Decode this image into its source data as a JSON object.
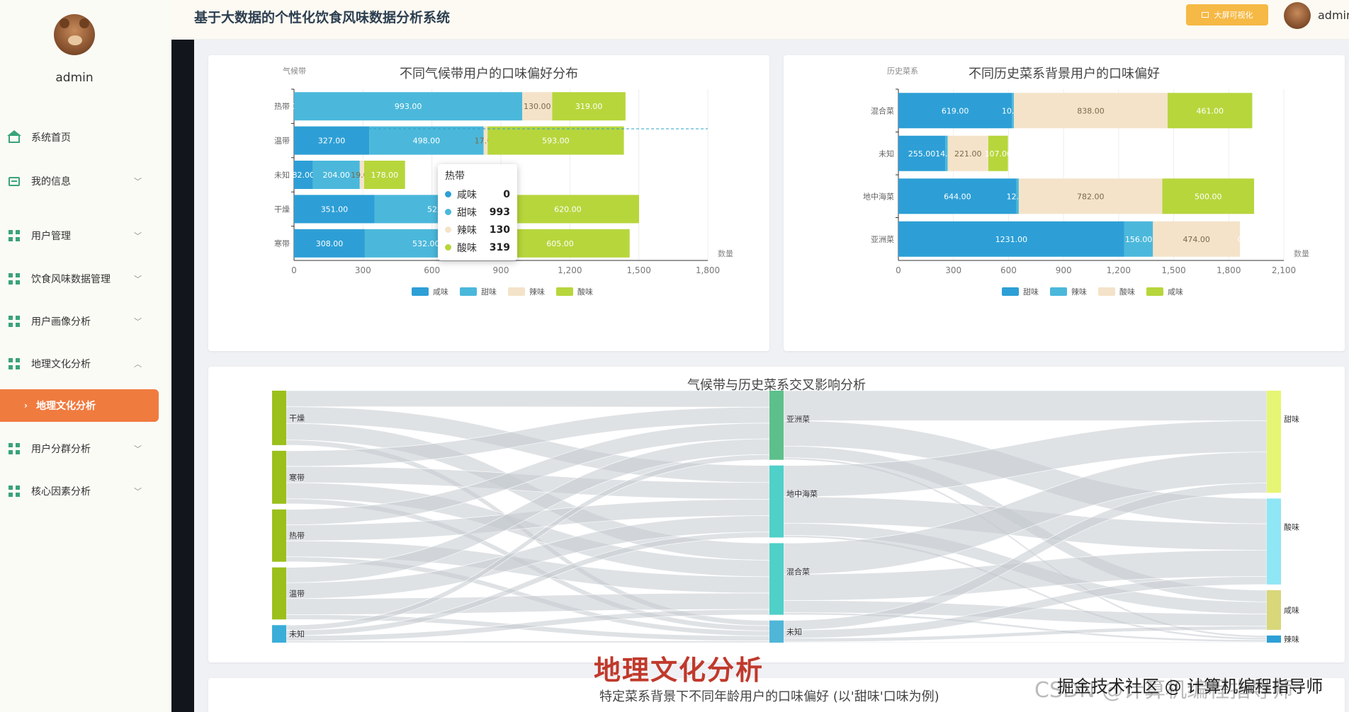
{
  "app": {
    "title": "基于大数据的个性化饮食风味数据分析系统",
    "big_screen_label": "大屏可视化",
    "username": "admin"
  },
  "sidebar": {
    "username": "admin",
    "items": [
      {
        "label": "系统首页",
        "icon": "home-icon"
      },
      {
        "label": "我的信息",
        "icon": "card-icon"
      },
      {
        "label": "用户管理",
        "icon": "grid-icon"
      },
      {
        "label": "饮食风味数据管理",
        "icon": "grid-icon"
      },
      {
        "label": "用户画像分析",
        "icon": "grid-icon"
      },
      {
        "label": "地理文化分析",
        "icon": "grid-icon"
      },
      {
        "label": "地理文化分析",
        "icon": "chevron-right-icon"
      },
      {
        "label": "用户分群分析",
        "icon": "grid-icon"
      },
      {
        "label": "核心因素分析",
        "icon": "grid-icon"
      }
    ]
  },
  "chart_data": [
    {
      "type": "bar",
      "orientation": "horizontal-stacked",
      "title": "不同气候带用户的口味偏好分布",
      "ylabel": "气候带",
      "xlabel": "数量",
      "categories": [
        "热带",
        "温带",
        "未知",
        "干燥",
        "寒带"
      ],
      "series": [
        {
          "name": "咸味",
          "color": "#2d9fd6",
          "values": [
            0,
            327,
            82,
            351,
            308
          ]
        },
        {
          "name": "甜味",
          "color": "#4bb8db",
          "values": [
            993,
            498,
            204,
            522,
            532
          ]
        },
        {
          "name": "辣味",
          "color": "#f4e3c9",
          "values": [
            130,
            17,
            19,
            8,
            15
          ]
        },
        {
          "name": "酸味",
          "color": "#b7d63c",
          "values": [
            319,
            593,
            178,
            620,
            605
          ]
        }
      ],
      "xlim": [
        0,
        1800
      ],
      "xticks": [
        "0",
        "300",
        "600",
        "900",
        "1,200",
        "1,500",
        "1,800"
      ],
      "labels": [
        [
          "0",
          "993.00",
          "130.00",
          "319.00"
        ],
        [
          "327.00",
          "498.00",
          "17.00",
          "593.00"
        ],
        [
          "82.00",
          "204.00",
          "19.00",
          "178.00"
        ],
        [
          "351.00",
          "522",
          "",
          "620.00"
        ],
        [
          "308.00",
          "532.00",
          "15.00",
          "605.00"
        ]
      ],
      "legend_position": "bottom",
      "tooltip": {
        "title": "热带",
        "rows": [
          [
            "咸味",
            "0"
          ],
          [
            "甜味",
            "993"
          ],
          [
            "辣味",
            "130"
          ],
          [
            "酸味",
            "319"
          ]
        ]
      }
    },
    {
      "type": "bar",
      "orientation": "horizontal-stacked",
      "title": "不同历史菜系背景用户的口味偏好",
      "ylabel": "历史菜系",
      "xlabel": "数量",
      "categories": [
        "混合菜",
        "未知",
        "地中海菜",
        "亚洲菜"
      ],
      "series": [
        {
          "name": "甜味",
          "color": "#2d9fd6",
          "values": [
            619,
            255,
            644,
            1231
          ]
        },
        {
          "name": "辣味",
          "color": "#4bb8db",
          "values": [
            10,
            14,
            12,
            156
          ]
        },
        {
          "name": "酸味",
          "color": "#f4e3c9",
          "values": [
            838,
            221,
            782,
            474
          ]
        },
        {
          "name": "咸味",
          "color": "#b7d63c",
          "values": [
            461,
            107,
            500,
            0
          ]
        }
      ],
      "xlim": [
        0,
        2100
      ],
      "xticks": [
        "0",
        "300",
        "600",
        "900",
        "1,200",
        "1,500",
        "1,800",
        "2,100"
      ],
      "labels": [
        [
          "619.00",
          "10.00",
          "838.00",
          "461.00"
        ],
        [
          "255.00",
          "14.00",
          "221.00",
          "107.00"
        ],
        [
          "644.00",
          "12.00",
          "782.00",
          "500.00"
        ],
        [
          "1231.00",
          "156.00",
          "474.00",
          "0"
        ]
      ],
      "legend_position": "bottom"
    },
    {
      "type": "sankey",
      "title": "气候带与历史菜系交叉影响分析",
      "columns": [
        [
          {
            "name": "干燥",
            "value": 1501,
            "color": "#9bc01c"
          },
          {
            "name": "寒带",
            "value": 1460,
            "color": "#9bc01c"
          },
          {
            "name": "热带",
            "value": 1442,
            "color": "#9bc01c"
          },
          {
            "name": "温带",
            "value": 1435,
            "color": "#9bc01c"
          },
          {
            "name": "未知",
            "value": 483,
            "color": "#3aaed8"
          }
        ],
        [
          {
            "name": "亚洲菜",
            "value": 1861,
            "color": "#5dc08a"
          },
          {
            "name": "地中海菜",
            "value": 1938,
            "color": "#4fd0c8"
          },
          {
            "name": "混合菜",
            "value": 1928,
            "color": "#4fd0c8"
          },
          {
            "name": "未知",
            "value": 597,
            "color": "#4fb6d8"
          }
        ],
        [
          {
            "name": "甜味",
            "value": 2749,
            "color": "#e6f573"
          },
          {
            "name": "酸味",
            "value": 2315,
            "color": "#8fe6f5"
          },
          {
            "name": "咸味",
            "value": 1068,
            "color": "#d8d77a"
          },
          {
            "name": "辣味",
            "value": 192,
            "color": "#2d9fd6"
          }
        ]
      ]
    }
  ],
  "overlay_title": "地理文化分析",
  "bottom_panel_title": "特定菜系背景下不同年龄用户的口味偏好 (以'甜味'口味为例)",
  "watermark": "CSDN @计算机编程指导师",
  "watermark_source": "掘金技术社区 @ 计算机编程指导师"
}
